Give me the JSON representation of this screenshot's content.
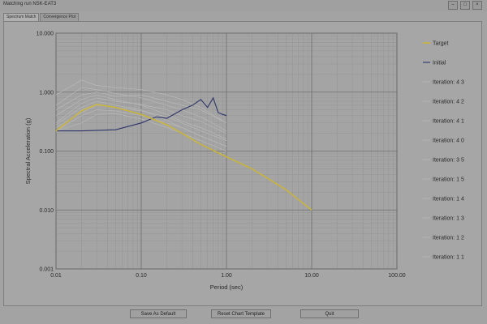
{
  "window": {
    "title": "Matching run NSK-EAT3"
  },
  "tabs": [
    {
      "label": "Spectrum Match"
    },
    {
      "label": "Convergence Plot"
    }
  ],
  "buttons": {
    "save_default": "Save As Default",
    "reset_template": "Reset Chart Template",
    "quit": "Quit"
  },
  "colors": {
    "target": "#c8b43c",
    "initial": "#2d3569",
    "iteration": "#b8b8b8",
    "plot_bg": "#a4a4a4",
    "grid": "#8a8a8a"
  },
  "chart_data": {
    "type": "line",
    "xlabel": "Period (sec)",
    "ylabel": "Spectral Acceleration (g)",
    "x_scale": "log",
    "y_scale": "log",
    "xlim": [
      0.01,
      100
    ],
    "ylim": [
      0.001,
      10
    ],
    "x_ticks": [
      "0.01",
      "0.10",
      "1.00",
      "10.00",
      "100.00"
    ],
    "y_ticks": [
      "0.001",
      "0.010",
      "0.100",
      "1.000",
      "10.000"
    ],
    "grid": true,
    "legend_position": "right",
    "series": [
      {
        "name": "Target",
        "color": "#c8b43c",
        "x": [
          0.01,
          0.015,
          0.02,
          0.03,
          0.05,
          0.1,
          0.2,
          0.3,
          0.5,
          1,
          2,
          3,
          5,
          10
        ],
        "y": [
          0.22,
          0.35,
          0.48,
          0.62,
          0.55,
          0.42,
          0.28,
          0.2,
          0.13,
          0.08,
          0.05,
          0.035,
          0.022,
          0.01
        ]
      },
      {
        "name": "Initial",
        "color": "#2d3569",
        "x": [
          0.01,
          0.02,
          0.05,
          0.1,
          0.15,
          0.2,
          0.3,
          0.4,
          0.5,
          0.6,
          0.7,
          0.8,
          0.9,
          1
        ],
        "y": [
          0.22,
          0.22,
          0.23,
          0.3,
          0.38,
          0.36,
          0.5,
          0.6,
          0.75,
          0.55,
          0.8,
          0.45,
          0.42,
          0.4
        ]
      },
      {
        "name": "Iteration: 4 3",
        "color": "#b8b8b8",
        "x": [
          0.01,
          0.02,
          0.03,
          0.05,
          0.1,
          0.2,
          0.3,
          0.5,
          1,
          2,
          5,
          10
        ],
        "y": [
          0.21,
          0.5,
          0.63,
          0.56,
          0.42,
          0.27,
          0.2,
          0.13,
          0.08,
          0.05,
          0.022,
          0.01
        ]
      },
      {
        "name": "Iteration: 4 2",
        "color": "#b8b8b8",
        "x": [
          0.01,
          0.02,
          0.03,
          0.05,
          0.1,
          0.2,
          0.3,
          0.5,
          1
        ],
        "y": [
          0.28,
          0.55,
          0.7,
          0.6,
          0.5,
          0.33,
          0.25,
          0.18,
          0.12
        ]
      },
      {
        "name": "Iteration: 4 1",
        "color": "#b8b8b8",
        "x": [
          0.01,
          0.02,
          0.03,
          0.05,
          0.1,
          0.2,
          0.3,
          0.5,
          1
        ],
        "y": [
          0.4,
          0.75,
          0.9,
          0.75,
          0.6,
          0.42,
          0.32,
          0.25,
          0.16
        ]
      },
      {
        "name": "Iteration: 4 0",
        "color": "#b8b8b8",
        "x": [
          0.01,
          0.02,
          0.03,
          0.05,
          0.1,
          0.2,
          0.3,
          0.5,
          1
        ],
        "y": [
          0.6,
          1.2,
          1.1,
          0.95,
          0.8,
          0.6,
          0.5,
          0.38,
          0.22
        ]
      },
      {
        "name": "Iteration: 3 5",
        "color": "#b8b8b8",
        "x": [
          0.01,
          0.02,
          0.03,
          0.05,
          0.1,
          0.2,
          0.3,
          0.5,
          1
        ],
        "y": [
          0.9,
          1.6,
          1.3,
          1.2,
          1.1,
          0.9,
          0.75,
          0.55,
          0.3
        ]
      },
      {
        "name": "Iteration: 1 5",
        "color": "#b8b8b8",
        "x": [
          0.01,
          0.02,
          0.03,
          0.05,
          0.1,
          0.2,
          0.3,
          0.5,
          1
        ],
        "y": [
          0.5,
          0.9,
          1.0,
          0.85,
          0.9,
          0.7,
          0.6,
          0.5,
          0.3
        ]
      },
      {
        "name": "Iteration: 1 4",
        "color": "#b8b8b8",
        "x": [
          0.01,
          0.02,
          0.03,
          0.05,
          0.1,
          0.2,
          0.3,
          0.5,
          1
        ],
        "y": [
          0.3,
          0.65,
          0.8,
          0.7,
          0.62,
          0.5,
          0.4,
          0.32,
          0.2
        ]
      },
      {
        "name": "Iteration: 1 3",
        "color": "#b8b8b8",
        "x": [
          0.01,
          0.02,
          0.03,
          0.05,
          0.1,
          0.2,
          0.3,
          0.5,
          1
        ],
        "y": [
          0.25,
          0.45,
          0.6,
          0.55,
          0.48,
          0.38,
          0.3,
          0.22,
          0.15
        ]
      },
      {
        "name": "Iteration: 1 2",
        "color": "#b8b8b8",
        "x": [
          0.01,
          0.02,
          0.03,
          0.05,
          0.1,
          0.2,
          0.3,
          0.5,
          1
        ],
        "y": [
          0.22,
          0.4,
          0.5,
          0.48,
          0.4,
          0.3,
          0.25,
          0.18,
          0.12
        ]
      },
      {
        "name": "Iteration: 1 1",
        "color": "#b8b8b8",
        "x": [
          0.01,
          0.02,
          0.03,
          0.05,
          0.1,
          0.2,
          0.3,
          0.5,
          1
        ],
        "y": [
          0.22,
          0.3,
          0.42,
          0.43,
          0.35,
          0.25,
          0.2,
          0.15,
          0.1
        ]
      }
    ]
  }
}
